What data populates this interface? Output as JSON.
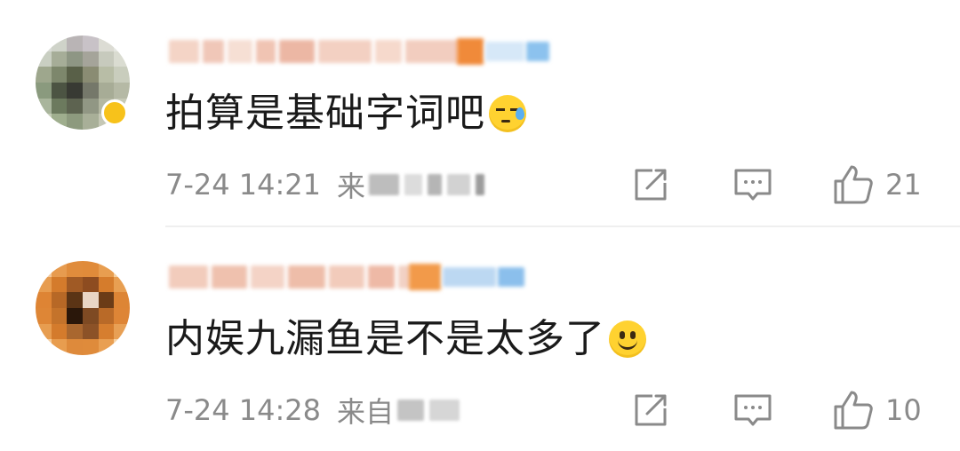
{
  "comments": [
    {
      "text": "拍算是基础字词吧",
      "emoji": "sweat-smile-emoji",
      "time": "7-24 14:21",
      "source_prefix": "来",
      "likes": "21"
    },
    {
      "text": "内娱九漏鱼是不是太多了",
      "emoji": "smile-emoji",
      "time": "7-24 14:28",
      "source_prefix": "来自",
      "likes": "10"
    }
  ],
  "icons": {
    "share": "share-icon",
    "comment": "comment-icon",
    "like": "thumbs-up-icon"
  },
  "colors": {
    "meta_gray": "#8a8a8a",
    "text": "#1a1a1a",
    "divider": "#efefef"
  }
}
